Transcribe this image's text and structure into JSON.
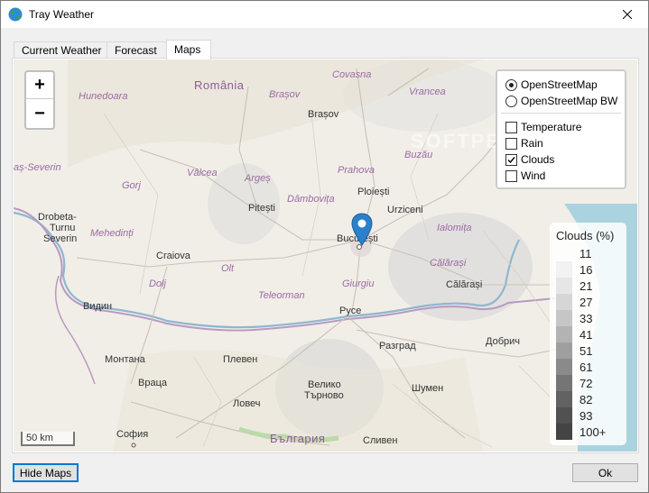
{
  "window": {
    "title": "Tray Weather"
  },
  "tabs": [
    {
      "label": "Current Weather"
    },
    {
      "label": "Forecast"
    },
    {
      "label": "Maps"
    }
  ],
  "map": {
    "zoom_in": "+",
    "zoom_out": "−",
    "scale": "50 km",
    "watermark": "SOFTPEDIA",
    "labels": {
      "romania": "România",
      "bulgaria": "България",
      "covasna": "Covasna",
      "vrancea": "Vrancea",
      "hunedoara": "Hunedoara",
      "brasov_region": "Brașov",
      "brasov": "Brașov",
      "severin": "aș-Severin",
      "buzau": "Buzău",
      "valcea": "Vâlcea",
      "arges": "Argeș",
      "prahova": "Prahova",
      "gorj": "Gorj",
      "dambovita": "Dâmbovița",
      "ploiesti": "Ploiești",
      "urziceni": "Urziceni",
      "pitesti": "Pitești",
      "drobeta": "Drobeta-",
      "turnu": "Turnu",
      "severin_city": "Severin",
      "mehedinti": "Mehedinți",
      "ialomita": "Ialomița",
      "craiova": "Craiova",
      "bucuresti": "București",
      "calarasi_region": "Călărași",
      "olt": "Olt",
      "dolj": "Dolj",
      "giurgiu": "Giurgiu",
      "calarasi": "Călărași",
      "teleorman": "Teleorman",
      "vidin": "Видин",
      "ruse": "Русе",
      "razgrad": "Разград",
      "dobrich": "Добрич",
      "montana": "Монтана",
      "pleven": "Плевен",
      "vratsa": "Враца",
      "veliko": "Велико",
      "tarnovo": "Търново",
      "shumen": "Шумен",
      "lovech": "Ловеч",
      "sofia": "София",
      "sliven": "Сливен"
    }
  },
  "layers": {
    "base": [
      {
        "label": "OpenStreetMap",
        "selected": true
      },
      {
        "label": "OpenStreetMap BW",
        "selected": false
      }
    ],
    "overlays": [
      {
        "label": "Temperature",
        "checked": false
      },
      {
        "label": "Rain",
        "checked": false
      },
      {
        "label": "Clouds",
        "checked": true
      },
      {
        "label": "Wind",
        "checked": false
      }
    ]
  },
  "legend": {
    "title": "Clouds (%)",
    "levels": [
      {
        "value": "11",
        "color": "#fdfdfd"
      },
      {
        "value": "16",
        "color": "#f2f2f2"
      },
      {
        "value": "21",
        "color": "#e6e6e6"
      },
      {
        "value": "27",
        "color": "#d6d6d6"
      },
      {
        "value": "33",
        "color": "#c6c6c6"
      },
      {
        "value": "41",
        "color": "#b3b3b3"
      },
      {
        "value": "51",
        "color": "#9f9f9f"
      },
      {
        "value": "61",
        "color": "#8a8a8a"
      },
      {
        "value": "72",
        "color": "#757575"
      },
      {
        "value": "82",
        "color": "#626262"
      },
      {
        "value": "93",
        "color": "#515151"
      },
      {
        "value": "100+",
        "color": "#444444"
      }
    ]
  },
  "buttons": {
    "hide_maps": "Hide Maps",
    "ok": "Ok"
  }
}
